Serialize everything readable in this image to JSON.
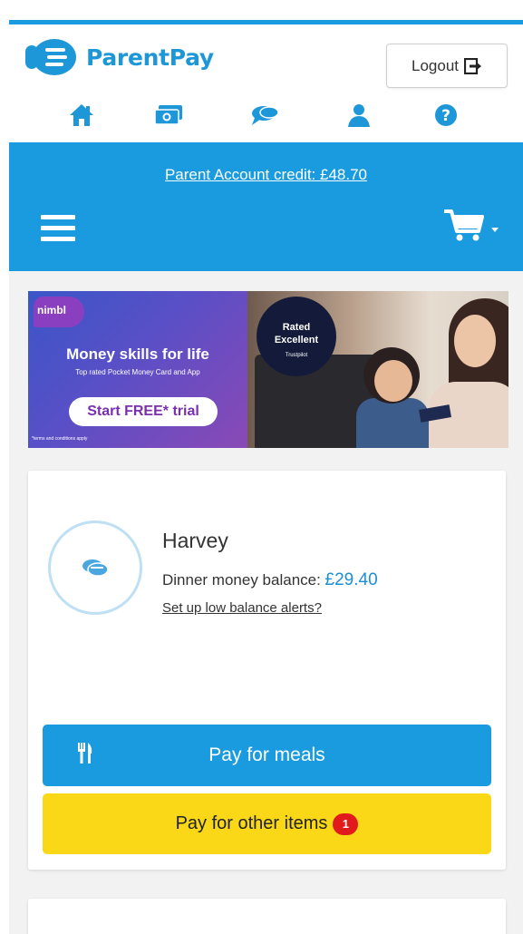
{
  "brand": {
    "name": "ParentPay",
    "color": "#1e97d8"
  },
  "header": {
    "logout_label": "Logout",
    "nav_icons": [
      "home-icon",
      "money-icon",
      "chat-icon",
      "user-icon",
      "help-icon"
    ]
  },
  "account": {
    "credit_link": "Parent Account credit: £48.70"
  },
  "banner": {
    "brand": "nimbl",
    "headline": "Money skills for life",
    "subline": "Top rated Pocket Money Card and App",
    "cta": "Start FREE* trial",
    "terms": "*terms and conditions apply",
    "rating_line1": "Rated",
    "rating_line2": "Excellent",
    "rating_source": "Trustpilot"
  },
  "child": {
    "name": "Harvey",
    "balance_label": "Dinner money balance: ",
    "balance_value": "£29.40",
    "alerts_link": "Set up low balance alerts?",
    "pay_meals_label": "Pay for meals",
    "pay_other_label": "Pay for other items",
    "pay_other_badge": "1"
  },
  "colors": {
    "primary": "#1a9be0",
    "yellow": "#fad817",
    "badge_red": "#e11b1b"
  }
}
